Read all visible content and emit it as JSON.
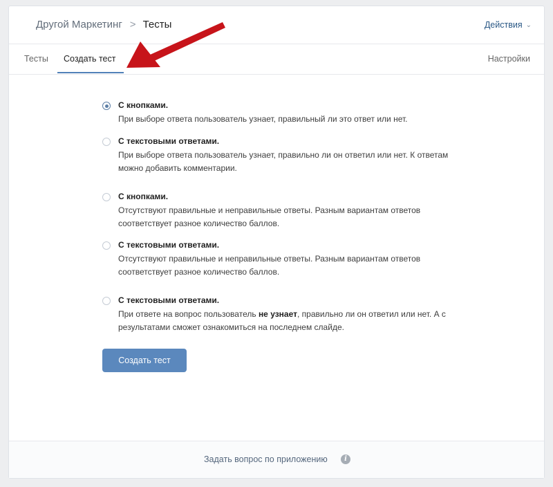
{
  "header": {
    "breadcrumb_root": "Другой Маркетинг",
    "breadcrumb_sep": ">",
    "breadcrumb_current": "Тесты",
    "actions_label": "Действия"
  },
  "tabs": [
    {
      "label": "Тесты"
    },
    {
      "label": "Создать тест",
      "active": true
    }
  ],
  "settings_label": "Настройки",
  "options": [
    {
      "title": "С кнопками.",
      "desc": "При выборе ответа пользователь узнает, правильный ли это ответ или нет.",
      "checked": true
    },
    {
      "title": "С текстовыми ответами.",
      "desc": "При выборе ответа пользователь узнает, правильно ли он ответил или нет. К ответам можно добавить комментарии.",
      "checked": false
    },
    {
      "title": "С кнопками.",
      "desc": "Отсутствуют правильные и неправильные ответы. Разным вариантам ответов соответствует разное количество баллов.",
      "checked": false
    },
    {
      "title": "С текстовыми ответами.",
      "desc": "Отсутствуют правильные и неправильные ответы. Разным вариантам ответов соответствует разное количество баллов.",
      "checked": false
    },
    {
      "title": "С текстовыми ответами.",
      "desc_pre": "При ответе на вопрос пользователь ",
      "desc_bold": "не узнает",
      "desc_post": ", правильно ли он ответил или нет. А с результатами сможет ознакомиться на последнем слайде.",
      "checked": false
    }
  ],
  "create_button_label": "Создать тест",
  "footer": {
    "question_link": "Задать вопрос по приложению",
    "info_icon_glyph": "i"
  },
  "colors": {
    "accent": "#5181b8",
    "button": "#5b88bd",
    "arrow": "#c7141a"
  },
  "icons": {
    "chevron": "chevron-right-icon",
    "dropdown": "chevron-down-icon",
    "info": "info-icon",
    "annotation": "red-arrow-icon"
  }
}
